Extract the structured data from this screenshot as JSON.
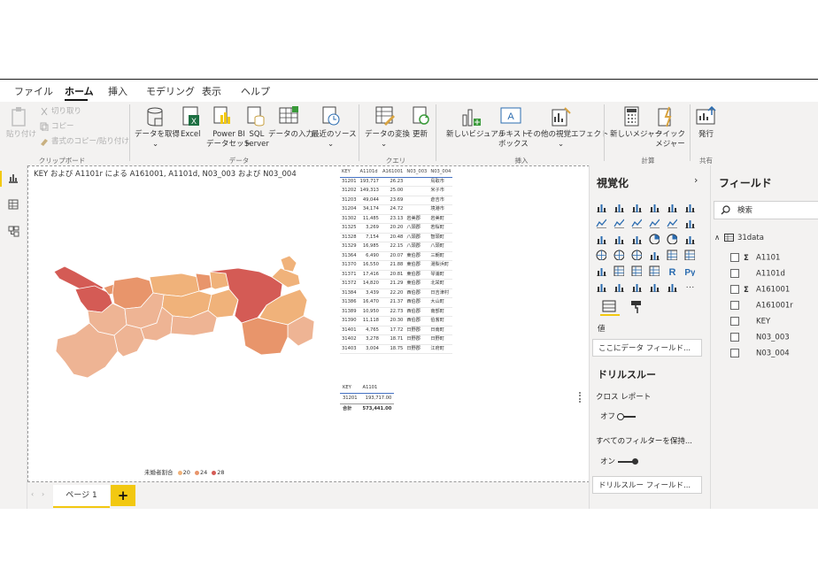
{
  "menu_tabs": [
    "ファイル",
    "ホーム",
    "挿入",
    "モデリング",
    "表示",
    "ヘルプ"
  ],
  "ribbon": {
    "clipboard": {
      "paste": "貼り付け",
      "cut": "切り取り",
      "copy": "コピー",
      "format_copy": "書式のコピー/貼り付け",
      "group": "クリップボード"
    },
    "data": {
      "get_data": "データを取得",
      "excel": "Excel",
      "pbi_line1": "Power BI",
      "pbi_line2": "データセット",
      "sql_line1": "SQL",
      "sql_line2": "Server",
      "enter_data": "データの入力",
      "recent_sources": "最近のソース",
      "group": "データ"
    },
    "queries": {
      "transform": "データの変換",
      "refresh": "更新",
      "group": "クエリ"
    },
    "insert": {
      "new_visual": "新しいビジュアル",
      "textbox_line1": "テキスト",
      "textbox_line2": "ボックス",
      "more_visuals": "その他の視覚エフェクト",
      "group": "挿入"
    },
    "calc": {
      "new_measure": "新しいメジャー",
      "quick_line1": "クイック",
      "quick_line2": "メジャー",
      "group": "計算"
    },
    "share": {
      "publish": "発行",
      "group": "共有"
    }
  },
  "visual_title": "KEY および A1101r による A161001, A1101d, N03_003 および N03_004",
  "table1": {
    "headers": [
      "KEY",
      "A1101d",
      "A161001",
      "N03_003",
      "N03_004"
    ],
    "rows": [
      [
        "31201",
        "193,717",
        "26.23",
        "",
        "鳥取市"
      ],
      [
        "31202",
        "149,313",
        "25.00",
        "",
        "米子市"
      ],
      [
        "31203",
        "49,044",
        "23.69",
        "",
        "倉吉市"
      ],
      [
        "31204",
        "34,174",
        "24.72",
        "",
        "境港市"
      ],
      [
        "31302",
        "11,485",
        "23.13",
        "岩美郡",
        "岩美町"
      ],
      [
        "31325",
        "3,269",
        "20.20",
        "八頭郡",
        "若桜町"
      ],
      [
        "31328",
        "7,154",
        "20.48",
        "八頭郡",
        "智頭町"
      ],
      [
        "31329",
        "16,985",
        "22.15",
        "八頭郡",
        "八頭町"
      ],
      [
        "31364",
        "6,490",
        "20.07",
        "東伯郡",
        "三朝町"
      ],
      [
        "31370",
        "16,550",
        "21.88",
        "東伯郡",
        "湯梨浜町"
      ],
      [
        "31371",
        "17,416",
        "20.81",
        "東伯郡",
        "琴浦町"
      ],
      [
        "31372",
        "14,820",
        "21.29",
        "東伯郡",
        "北栄町"
      ],
      [
        "31384",
        "3,439",
        "22.20",
        "西伯郡",
        "日吉津村"
      ],
      [
        "31386",
        "16,470",
        "21.37",
        "西伯郡",
        "大山町"
      ],
      [
        "31389",
        "10,950",
        "22.73",
        "西伯郡",
        "南部町"
      ],
      [
        "31390",
        "11,118",
        "20.30",
        "西伯郡",
        "伯耆町"
      ],
      [
        "31401",
        "4,765",
        "17.72",
        "日野郡",
        "日南町"
      ],
      [
        "31402",
        "3,278",
        "18.71",
        "日野郡",
        "日野町"
      ],
      [
        "31403",
        "3,004",
        "18.75",
        "日野郡",
        "江府町"
      ]
    ]
  },
  "table2": {
    "headers": [
      "KEY",
      "A1101"
    ],
    "rows": [
      [
        "31201",
        "193,717.00"
      ]
    ],
    "total_label": "合計",
    "total_value": "573,441.00"
  },
  "legend": {
    "title": "未婚者割合",
    "items": [
      {
        "label": "20",
        "color": "#f0b27a"
      },
      {
        "label": "24",
        "color": "#e8956b"
      },
      {
        "label": "28",
        "color": "#d45b55"
      }
    ]
  },
  "page_tab": "ページ 1",
  "add_page": "+",
  "viz_pane": {
    "title": "視覚化",
    "values_label": "値",
    "values_placeholder": "ここにデータ フィールド...",
    "drillthrough_title": "ドリルスルー",
    "cross_report": "クロス レポート",
    "off_label": "オフ",
    "keep_filters": "すべてのフィルターを保持...",
    "on_label": "オン",
    "drill_placeholder": "ドリルスルー フィールド..."
  },
  "field_pane": {
    "title": "フィールド",
    "search_placeholder": "検索",
    "table_name": "31data",
    "fields": [
      {
        "name": "A1101",
        "sigma": true
      },
      {
        "name": "A1101d",
        "sigma": false
      },
      {
        "name": "A161001",
        "sigma": true
      },
      {
        "name": "A161001r",
        "sigma": false
      },
      {
        "name": "KEY",
        "sigma": false
      },
      {
        "name": "N03_003",
        "sigma": false
      },
      {
        "name": "N03_004",
        "sigma": false
      }
    ]
  },
  "colors": {
    "accent": "#f2c811",
    "map_dark": "#d45b55",
    "map_mid": "#e8956b",
    "map_light": "#f0b27a",
    "map_pale": "#eeb494"
  }
}
